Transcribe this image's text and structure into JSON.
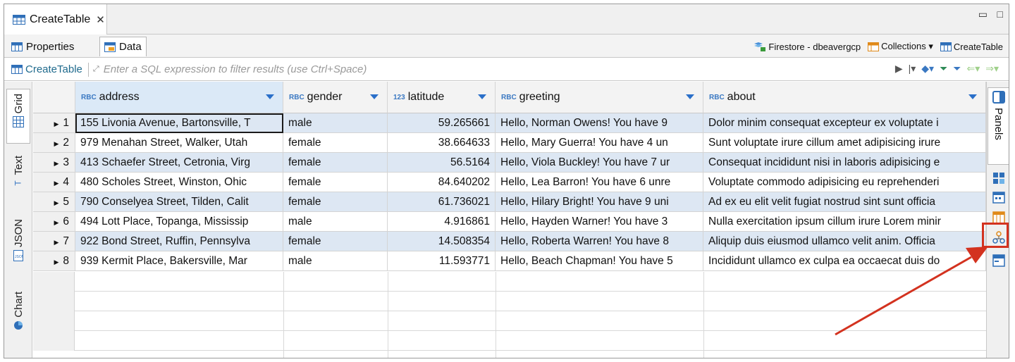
{
  "editor_tab": {
    "label": "CreateTable",
    "close": "✕"
  },
  "window_controls": {
    "minimize": "▭",
    "maximize": "□"
  },
  "subtabs": [
    {
      "label": "Properties"
    },
    {
      "label": "Data"
    }
  ],
  "breadcrumbs": [
    {
      "label": "Firestore - dbeavergcp"
    },
    {
      "label": "Collections ▾"
    },
    {
      "label": "CreateTable"
    }
  ],
  "filter": {
    "table_name": "CreateTable",
    "placeholder": "Enter a SQL expression to filter results (use Ctrl+Space)"
  },
  "left_tabs": [
    {
      "label": "Grid"
    },
    {
      "label": "Text"
    },
    {
      "label": "JSON"
    },
    {
      "label": "Chart"
    }
  ],
  "right_panel": {
    "label": "Panels"
  },
  "columns": [
    {
      "type": "RBC",
      "name": "address"
    },
    {
      "type": "RBC",
      "name": "gender"
    },
    {
      "type": "123",
      "name": "latitude"
    },
    {
      "type": "RBC",
      "name": "greeting"
    },
    {
      "type": "RBC",
      "name": "about"
    }
  ],
  "rows": [
    {
      "n": "1",
      "address": "155 Livonia Avenue, Bartonsville, T",
      "gender": "male",
      "latitude": "59.265661",
      "greeting": "Hello, Norman Owens! You have 9",
      "about": "Dolor minim consequat excepteur ex voluptate i"
    },
    {
      "n": "2",
      "address": "979 Menahan Street, Walker, Utah",
      "gender": "female",
      "latitude": "38.664633",
      "greeting": "Hello, Mary Guerra! You have 4 un",
      "about": "Sunt voluptate irure cillum amet adipisicing irure"
    },
    {
      "n": "3",
      "address": "413 Schaefer Street, Cetronia, Virg",
      "gender": "female",
      "latitude": "56.5164",
      "greeting": "Hello, Viola Buckley! You have 7 ur",
      "about": "Consequat incididunt nisi in laboris adipisicing e"
    },
    {
      "n": "4",
      "address": "480 Scholes Street, Winston, Ohic",
      "gender": "female",
      "latitude": "84.640202",
      "greeting": "Hello, Lea Barron! You have 6 unre",
      "about": "Voluptate commodo adipisicing eu reprehenderi"
    },
    {
      "n": "5",
      "address": "790 Conselyea Street, Tilden, Calit",
      "gender": "female",
      "latitude": "61.736021",
      "greeting": "Hello, Hilary Bright! You have 9 uni",
      "about": "Ad ex eu elit velit fugiat nostrud sint sunt officia"
    },
    {
      "n": "6",
      "address": "494 Lott Place, Topanga, Mississip",
      "gender": "male",
      "latitude": "4.916861",
      "greeting": "Hello, Hayden Warner! You have 3",
      "about": "Nulla exercitation ipsum cillum irure Lorem minir"
    },
    {
      "n": "7",
      "address": "922 Bond Street, Ruffin, Pennsylva",
      "gender": "female",
      "latitude": "14.508354",
      "greeting": "Hello, Roberta Warren! You have 8",
      "about": "Aliquip duis eiusmod ullamco velit anim. Officia"
    },
    {
      "n": "8",
      "address": "939 Kermit Place, Bakersville, Mar",
      "gender": "male",
      "latitude": "11.593771",
      "greeting": "Hello, Beach Chapman! You have 5",
      "about": "Incididunt ullamco ex culpa ea occaecat duis do"
    }
  ],
  "colors": {
    "accent": "#2a6fc9",
    "highlight": "#d3321f",
    "row_stripe": "#dde7f3"
  }
}
